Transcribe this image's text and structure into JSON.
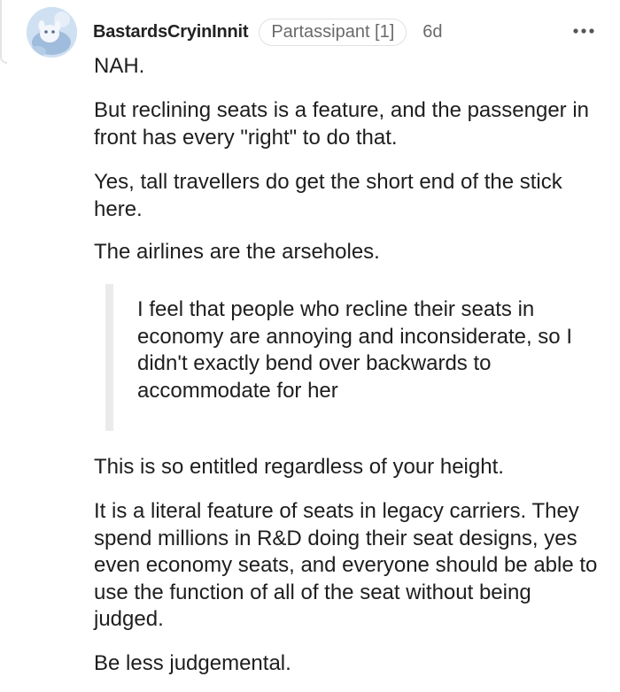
{
  "comment": {
    "author": "BastardsCryinInnit",
    "flair": "Partassipant [1]",
    "age": "6d",
    "more_icon": "more-horizontal-icon",
    "avatar_icon": "avatar",
    "paragraphs": [
      "NAH.",
      "But reclining seats is a feature, and the passenger in front has every \"right\" to do that.",
      "Yes, tall travellers do get the short end of the stick here.",
      "The airlines are the arseholes."
    ],
    "quote": "I feel that people who recline their seats in economy are annoying and inconsiderate, so I didn't exactly bend over backwards to accommodate for her",
    "after_quote": [
      "This is so entitled regardless of your height.",
      "It is a literal feature of seats in legacy carriers. They spend millions in R&D doing their seat designs, yes even economy seats, and everyone should be able to use the function of all of the seat without being judged.",
      "Be less judgemental."
    ]
  }
}
